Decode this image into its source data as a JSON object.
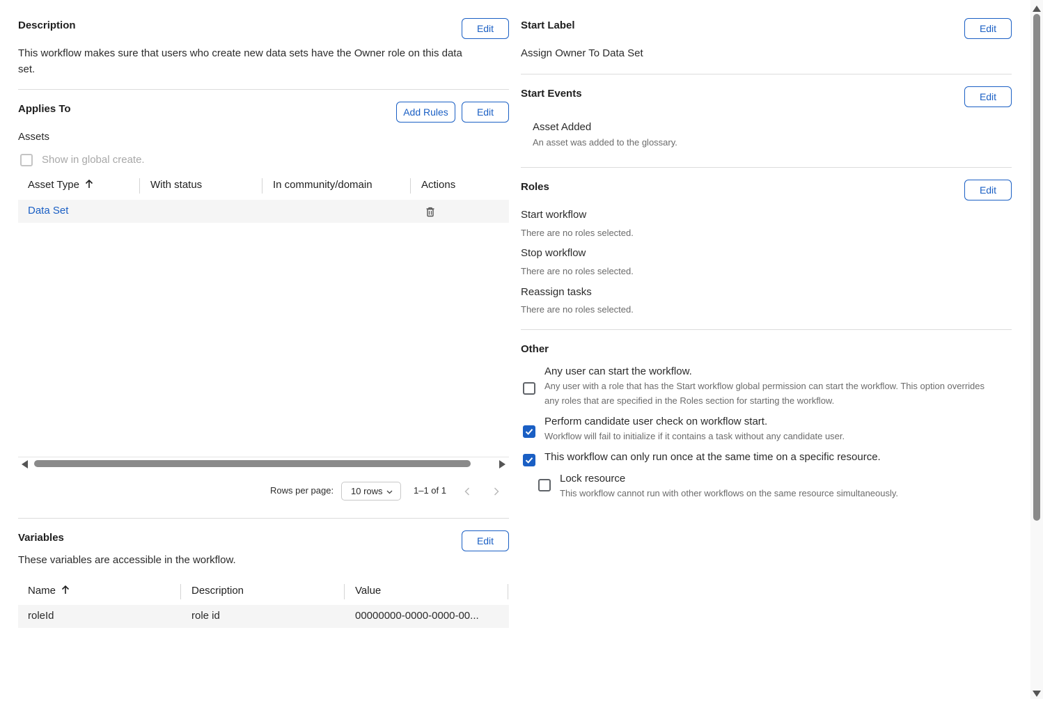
{
  "description": {
    "title": "Description",
    "edit_label": "Edit",
    "text_line1": "This workflow makes sure that users who create new data sets have the Owner role on this data",
    "text_line2": "set."
  },
  "applies_to": {
    "title": "Applies To",
    "add_rules_label": "Add Rules",
    "edit_label": "Edit",
    "subtitle": "Assets",
    "show_global_create": "Show in global create.",
    "columns": [
      "Asset Type",
      "With status",
      "In community/domain",
      "Actions"
    ],
    "rows": [
      {
        "asset_type": "Data Set",
        "with_status": "",
        "community": "",
        "action_icon": "trash-icon"
      }
    ],
    "rows_per_page_label": "Rows per page:",
    "rows_per_page_value": "10 rows",
    "range": "1–1 of 1"
  },
  "variables": {
    "title": "Variables",
    "edit_label": "Edit",
    "subtitle": "These variables are accessible in the workflow.",
    "columns": [
      "Name",
      "Description",
      "Value"
    ],
    "rows": [
      {
        "name": "roleId",
        "description": "role id",
        "value": "00000000-0000-0000-00..."
      }
    ]
  },
  "start_label": {
    "title": "Start Label",
    "edit_label": "Edit",
    "value": "Assign Owner To Data Set"
  },
  "start_events": {
    "title": "Start Events",
    "edit_label": "Edit",
    "event_name": "Asset Added",
    "event_desc": "An asset was added to the glossary."
  },
  "roles": {
    "title": "Roles",
    "edit_label": "Edit",
    "items": [
      {
        "label": "Start workflow",
        "value": "There are no roles selected."
      },
      {
        "label": "Stop workflow",
        "value": "There are no roles selected."
      },
      {
        "label": "Reassign tasks",
        "value": "There are no roles selected."
      }
    ]
  },
  "other": {
    "title": "Other",
    "options": [
      {
        "label": "Any user can start the workflow.",
        "desc_line1": "Any user with a role that has the Start workflow global permission can start the workflow. This option overrides",
        "desc_line2": "any roles that are specified in the Roles section for starting the workflow.",
        "checked": false
      },
      {
        "label": "Perform candidate user check on workflow start.",
        "desc_line1": "Workflow will fail to initialize if it contains a task without any candidate user.",
        "checked": true
      },
      {
        "label": "This workflow can only run once at the same time on a specific resource.",
        "checked": true
      },
      {
        "label": "Lock resource",
        "desc_line1": "This workflow cannot run with other workflows on the same resource simultaneously.",
        "checked": false
      }
    ]
  },
  "colors": {
    "accent": "#1a5fc4",
    "row_bg": "#f5f5f5",
    "divider": "#dcdcdc"
  }
}
